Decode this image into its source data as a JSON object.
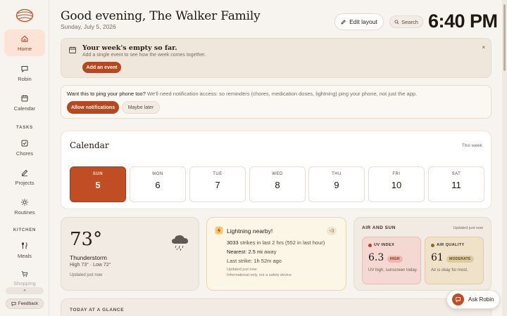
{
  "sidebar": {
    "items": [
      {
        "label": "Home",
        "icon": "home-icon"
      },
      {
        "label": "Robin",
        "icon": "chat-icon"
      },
      {
        "label": "Calendar",
        "icon": "calendar-icon"
      },
      {
        "label": "Chores",
        "icon": "checkbox-icon"
      },
      {
        "label": "Projects",
        "icon": "pencil-icon"
      },
      {
        "label": "Routines",
        "icon": "sun-icon"
      },
      {
        "label": "Meals",
        "icon": "utensils-icon"
      },
      {
        "label": "Shopping",
        "icon": "cart-icon"
      }
    ],
    "sections": {
      "tasks": "TASKS",
      "kitchen": "KITCHEN"
    },
    "collapse_label": "»",
    "feedback_label": "Feedback"
  },
  "header": {
    "greeting": "Good evening, The Walker Family",
    "date": "Sunday, July 5, 2026",
    "edit_label": "Edit layout",
    "search_label": "Search",
    "clock": "6:40 PM"
  },
  "banner": {
    "title": "Your week's empty so far.",
    "subtitle": "Add a single event to see how the week comes together.",
    "button": "Add an event",
    "close": "×"
  },
  "notifications": {
    "question": "Want this to ping your phone too?",
    "detail": " We'll need notification access: so reminders (chores, medication doses, lightning) ping your phone, not just the app.",
    "allow": "Allow notifications",
    "later": "Maybe later"
  },
  "calendar": {
    "title": "Calendar",
    "range": "This week",
    "days": [
      {
        "name": "SUN",
        "date": "5",
        "today": true
      },
      {
        "name": "MON",
        "date": "6"
      },
      {
        "name": "TUE",
        "date": "7"
      },
      {
        "name": "WED",
        "date": "8"
      },
      {
        "name": "THU",
        "date": "9"
      },
      {
        "name": "FRI",
        "date": "10"
      },
      {
        "name": "SAT",
        "date": "11"
      }
    ]
  },
  "weather": {
    "temp": "73°",
    "condition": "Thunderstorm",
    "high_low": "High 73° · Low 72°",
    "updated": "Updated just now",
    "icon": "storm-cloud-icon"
  },
  "lightning": {
    "title": "Lightning nearby!",
    "strikes_count": "3033",
    "strikes_text": " strikes in last 2 hrs (552 in last hour)",
    "nearest_label": "Nearest: ",
    "nearest_value": "2.5 mi",
    "nearest_suffix": " away",
    "last_strike": "Last strike: 1h 52m ago",
    "updated": "Updated just now",
    "disclaimer": "Informational only, not a safety device",
    "mute": "◁)"
  },
  "air": {
    "title": "AIR AND SUN",
    "updated": "Updated just now",
    "uv": {
      "label": "UV INDEX",
      "value": "6.3",
      "badge": "HIGH",
      "desc": "UV high, sunscreen today.",
      "dot_color": "#c0392b"
    },
    "aq": {
      "label": "AIR QUALITY",
      "value": "61",
      "badge": "MODERATE",
      "desc": "Air is okay for most.",
      "dot_color": "#8a6a1f"
    }
  },
  "glance": {
    "title": "TODAY AT A GLANCE"
  },
  "ask": {
    "label": "Ask Robin"
  },
  "colors": {
    "accent": "#b8461f",
    "today": "#c14d24"
  }
}
